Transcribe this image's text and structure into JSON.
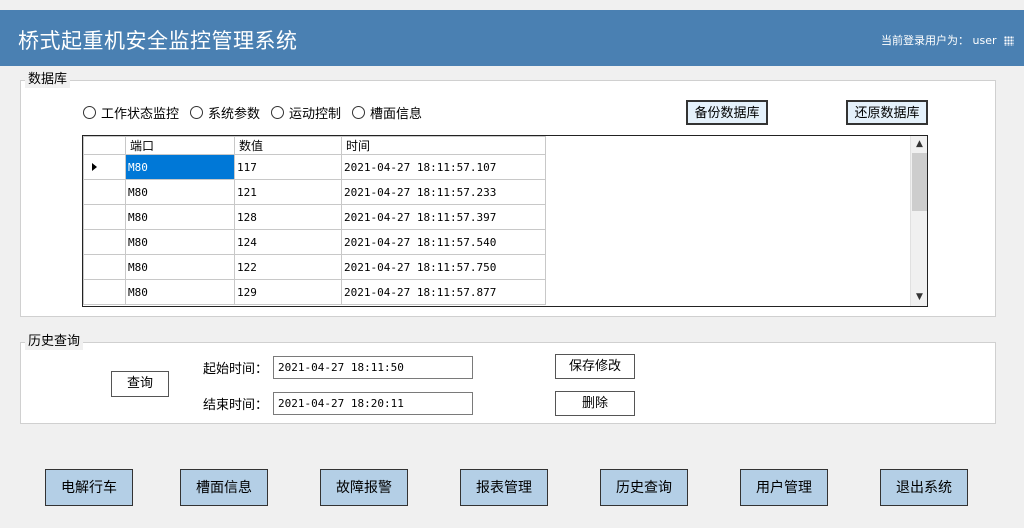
{
  "header": {
    "title": "桥式起重机安全监控管理系统",
    "user_label": "当前登录用户为：",
    "username": "user"
  },
  "database": {
    "legend": "数据库",
    "radios": [
      "工作状态监控",
      "系统参数",
      "运动控制",
      "槽面信息"
    ],
    "backup_label": "备份数据库",
    "restore_label": "还原数据库",
    "grid": {
      "columns": [
        "端口",
        "数值",
        "时间"
      ],
      "rows": [
        {
          "port": "M80",
          "value": "117",
          "time": "2021-04-27 18:11:57.107"
        },
        {
          "port": "M80",
          "value": "121",
          "time": "2021-04-27 18:11:57.233"
        },
        {
          "port": "M80",
          "value": "128",
          "time": "2021-04-27 18:11:57.397"
        },
        {
          "port": "M80",
          "value": "124",
          "time": "2021-04-27 18:11:57.540"
        },
        {
          "port": "M80",
          "value": "122",
          "time": "2021-04-27 18:11:57.750"
        },
        {
          "port": "M80",
          "value": "129",
          "time": "2021-04-27 18:11:57.877"
        }
      ]
    }
  },
  "history": {
    "legend": "历史查询",
    "query_label": "查询",
    "start_label": "起始时间：",
    "start_value": "2021-04-27 18:11:50",
    "end_label": "结束时间：",
    "end_value": "2021-04-27 18:20:11",
    "save_label": "保存修改",
    "delete_label": "删除"
  },
  "nav": [
    "电解行车",
    "槽面信息",
    "故障报警",
    "报表管理",
    "历史查询",
    "用户管理",
    "退出系统"
  ],
  "colors": {
    "titlebar": "#4a80b2",
    "nav_button": "#b4cfe6",
    "selection": "#0078d7"
  }
}
